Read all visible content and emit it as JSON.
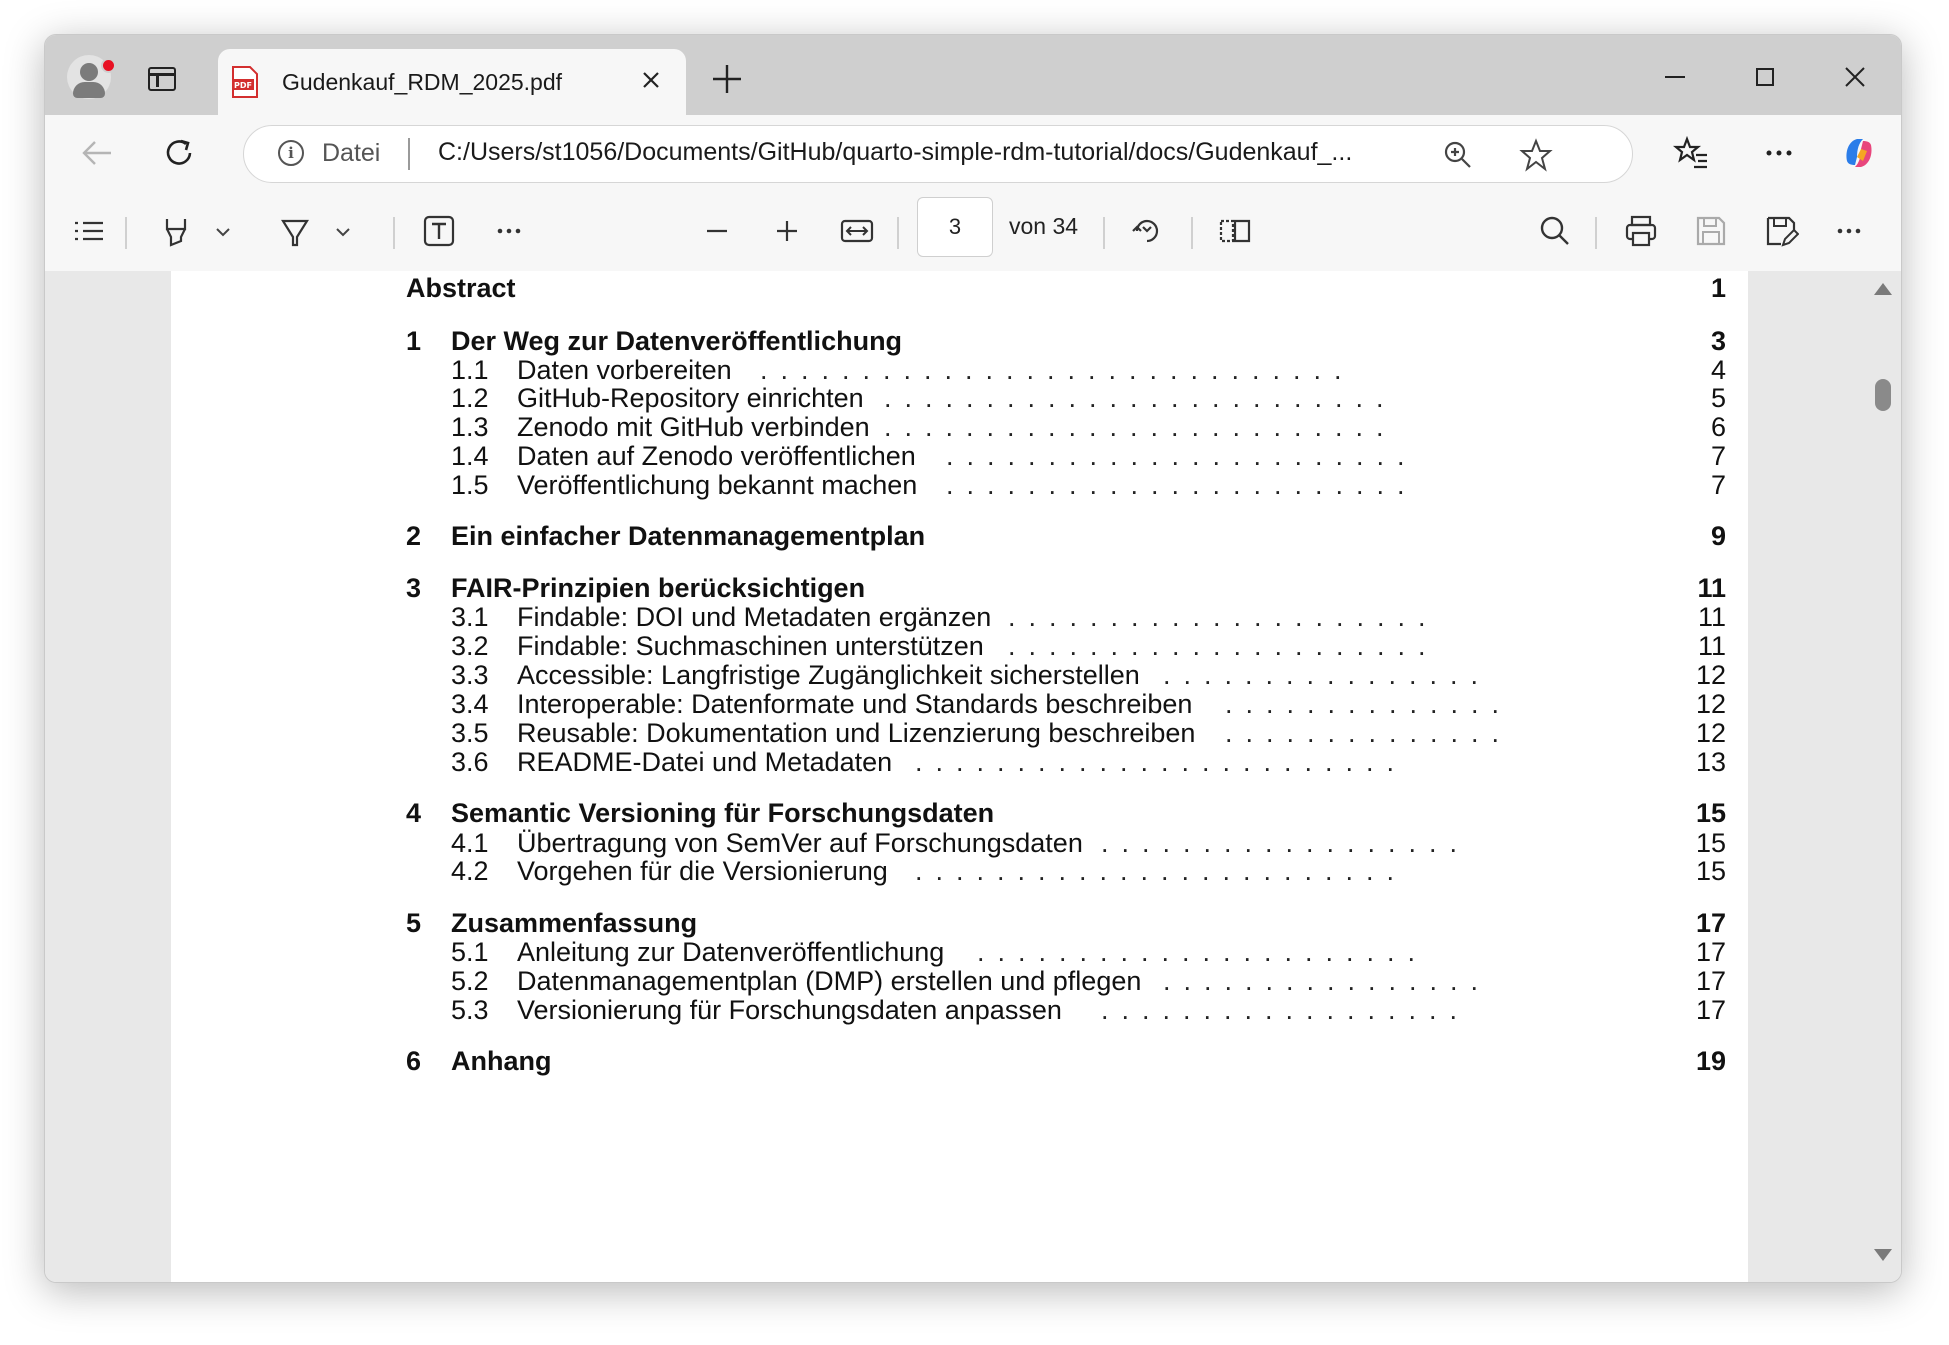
{
  "browser": {
    "tab_title": "Gudenkauf_RDM_2025.pdf",
    "address_scheme": "Datei",
    "address_url": "C:/Users/st1056/Documents/GitHub/quarto-simple-rdm-tutorial/docs/Gudenkauf_..."
  },
  "pdf_toolbar": {
    "current_page": "3",
    "page_count": "von 34"
  },
  "toc": {
    "abstract": {
      "title": "Abstract",
      "page": "1"
    },
    "s1": {
      "num": "1",
      "title": "Der Weg zur Datenveröffentlichung",
      "page": "3",
      "subs": [
        {
          "num": "1.1",
          "title": "Daten vorbereiten",
          "page": "4"
        },
        {
          "num": "1.2",
          "title": "GitHub-Repository einrichten",
          "page": "5"
        },
        {
          "num": "1.3",
          "title": "Zenodo mit GitHub verbinden",
          "page": "6"
        },
        {
          "num": "1.4",
          "title": "Daten auf Zenodo veröffentlichen",
          "page": "7"
        },
        {
          "num": "1.5",
          "title": "Veröffentlichung bekannt machen",
          "page": "7"
        }
      ]
    },
    "s2": {
      "num": "2",
      "title": "Ein einfacher Datenmanagementplan",
      "page": "9"
    },
    "s3": {
      "num": "3",
      "title": "FAIR-Prinzipien berücksichtigen",
      "page": "11",
      "subs": [
        {
          "num": "3.1",
          "title": "Findable: DOI und Metadaten ergänzen",
          "page": "11"
        },
        {
          "num": "3.2",
          "title": "Findable: Suchmaschinen unterstützen",
          "page": "11"
        },
        {
          "num": "3.3",
          "title": "Accessible: Langfristige Zugänglichkeit sicherstellen",
          "page": "12"
        },
        {
          "num": "3.4",
          "title": "Interoperable: Datenformate und Standards beschreiben",
          "page": "12"
        },
        {
          "num": "3.5",
          "title": "Reusable: Dokumentation und Lizenzierung beschreiben",
          "page": "12"
        },
        {
          "num": "3.6",
          "title": "README-Datei und Metadaten",
          "page": "13"
        }
      ]
    },
    "s4": {
      "num": "4",
      "title": "Semantic Versioning für Forschungsdaten",
      "page": "15",
      "subs": [
        {
          "num": "4.1",
          "title": "Übertragung von SemVer auf Forschungsdaten",
          "page": "15"
        },
        {
          "num": "4.2",
          "title": "Vorgehen für die Versionierung",
          "page": "15"
        }
      ]
    },
    "s5": {
      "num": "5",
      "title": "Zusammenfassung",
      "page": "17",
      "subs": [
        {
          "num": "5.1",
          "title": "Anleitung zur Datenveröffentlichung",
          "page": "17"
        },
        {
          "num": "5.2",
          "title": "Datenmanagementplan (DMP) erstellen und pflegen",
          "page": "17"
        },
        {
          "num": "5.3",
          "title": "Versionierung für Forschungsdaten anpassen",
          "page": "17"
        }
      ]
    },
    "s6": {
      "num": "6",
      "title": "Anhang",
      "page": "19"
    }
  }
}
